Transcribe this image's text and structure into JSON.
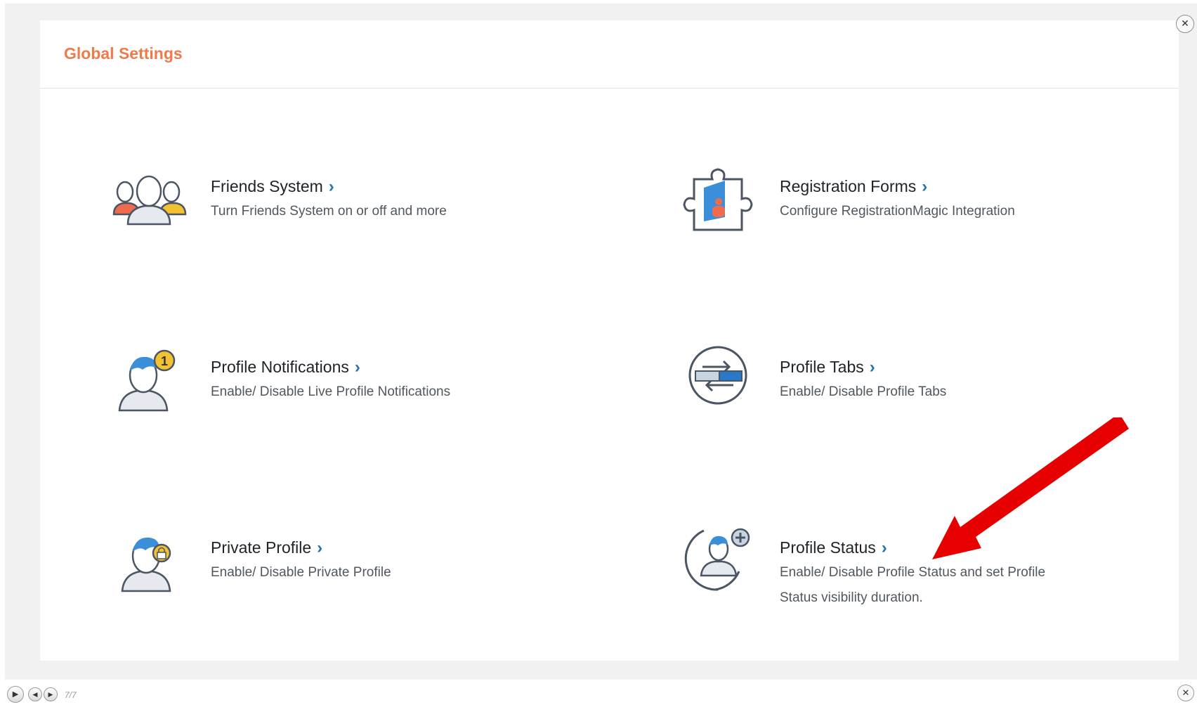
{
  "panel": {
    "title": "Global Settings"
  },
  "cards": [
    {
      "title": "Friends System",
      "description": "Turn Friends System on or off and more",
      "icon": "friends-group-icon"
    },
    {
      "title": "Registration Forms",
      "description": "Configure RegistrationMagic Integration",
      "icon": "puzzle-piece-icon"
    },
    {
      "title": "Profile Notifications",
      "description": "Enable/ Disable Live Profile Notifications",
      "icon": "user-notification-icon"
    },
    {
      "title": "Profile Tabs",
      "description": "Enable/ Disable Profile Tabs",
      "icon": "swap-tabs-icon"
    },
    {
      "title": "Private Profile",
      "description": "Enable/ Disable Private Profile",
      "icon": "user-lock-icon"
    },
    {
      "title": "Profile Status",
      "description": "Enable/ Disable Profile Status and set Profile Status visibility duration.",
      "icon": "user-status-icon"
    }
  ],
  "chevron": "›",
  "viewer": {
    "counter": "7/7"
  },
  "colors": {
    "accent": "#ef7b4d",
    "link": "#2271b1",
    "arrow": "#e60000"
  }
}
